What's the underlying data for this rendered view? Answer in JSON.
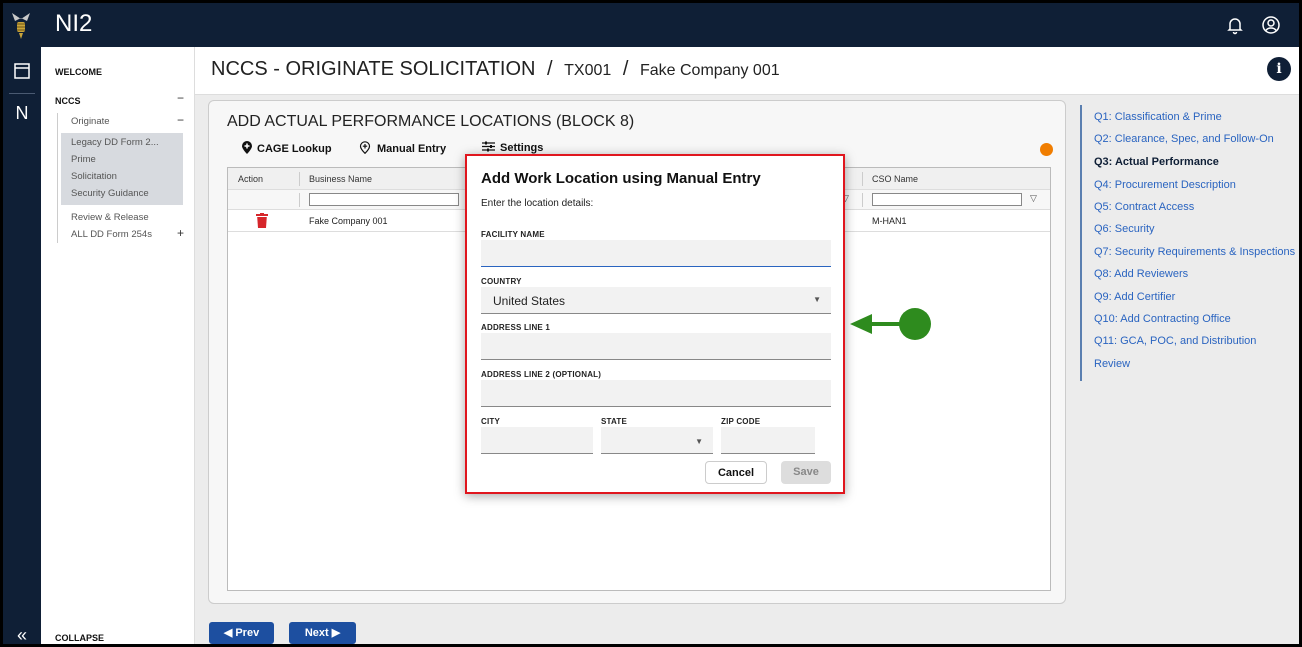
{
  "app": {
    "name": "NI2"
  },
  "nav": {
    "welcome": "WELCOME",
    "nccs": "NCCS",
    "nccs_sign": "−",
    "originate": "Originate",
    "originate_sign": "−",
    "sub_items": [
      "Legacy DD Form 2...",
      "Prime",
      "Solicitation",
      "Security Guidance"
    ],
    "review_release": "Review & Release",
    "all_forms": "ALL DD Form 254s",
    "all_forms_sign": "+",
    "collapse": "COLLAPSE",
    "collapse_icon": "«"
  },
  "header": {
    "title": "NCCS - ORIGINATE SOLICITATION",
    "sep": "/",
    "crumb1": "TX001",
    "crumb2": "Fake Company 001",
    "info_icon": "i"
  },
  "card": {
    "title": "ADD ACTUAL PERFORMANCE LOCATIONS (BLOCK 8)",
    "tools": {
      "cage": "CAGE Lookup",
      "manual": "Manual Entry",
      "settings": "Settings"
    },
    "grid": {
      "columns": [
        "Action",
        "Business Name",
        "CSO Name"
      ],
      "rows": [
        {
          "business_name": "Fake Company 001",
          "cso_name": "M-HAN1"
        }
      ]
    }
  },
  "footer": {
    "prev": "Prev",
    "next": "Next"
  },
  "steps": [
    "Q1: Classification & Prime",
    "Q2: Clearance, Spec, and Follow-On",
    "Q3: Actual Performance",
    "Q4: Procurement Description",
    "Q5: Contract Access",
    "Q6: Security",
    "Q7: Security Requirements & Inspections",
    "Q8: Add Reviewers",
    "Q9: Add Certifier",
    "Q10: Add Contracting Office",
    "Q11: GCA, POC, and Distribution",
    "Review"
  ],
  "active_step": "Q3: Actual Performance",
  "modal": {
    "title": "Add Work Location using Manual Entry",
    "subtitle": "Enter the location details:",
    "facility_label": "FACILITY NAME",
    "facility_value": "",
    "country_label": "COUNTRY",
    "country_value": "United States",
    "address1_label": "ADDRESS LINE 1",
    "address1_value": "",
    "address2_label": "ADDRESS LINE 2 (OPTIONAL)",
    "address2_value": "",
    "city_label": "CITY",
    "state_label": "STATE",
    "zip_label": "ZIP CODE",
    "cancel": "Cancel",
    "save": "Save"
  },
  "colors": {
    "navy": "#0f1f36",
    "accent_blue": "#1d4fa0",
    "link_blue": "#2a64c0",
    "highlight_red": "#e0161e",
    "annotation_green": "#2e8b1e",
    "trash_red": "#d6262b",
    "badge_orange": "#f07d00"
  }
}
